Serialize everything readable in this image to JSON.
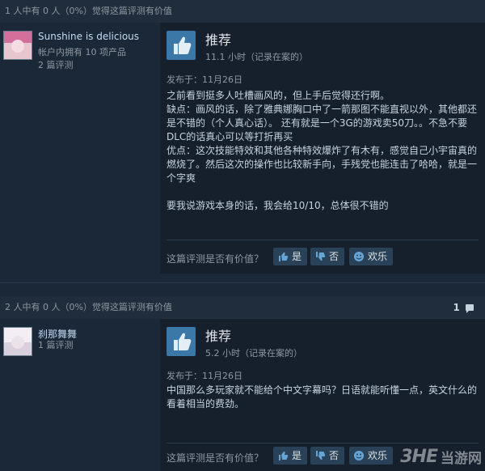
{
  "reviews": [
    {
      "helpful_text": "1 人中有 0 人（0%）觉得这篇评测有价值",
      "comment_count": "",
      "username": "Sunshine is delicious",
      "products_owned": "帐户内拥有 10 项产品",
      "review_count": "2 篇评测",
      "recommendation": "推荐",
      "hours": "11.1 小时（记录在案的）",
      "posted": "发布于：11月26日",
      "body": [
        "之前看到挺多人吐槽画风的，但上手后觉得还行啊。",
        "缺点：画风的话，除了雅典娜胸口中了一箭那图不能直视以外，其他都还是不错的（个人真心话）。 还有就是一个3G的游戏卖50刀。。不急不要DLC的话真心可以等打折再买",
        "优点：这次技能特效和其他各种特效爆炸了有木有，感觉自己小宇宙真的燃烧了。然后这次的操作也比较新手向，手残党也能连击了哈哈，就是一个字爽",
        "",
        "要我说游戏本身的话，我会给10/10，总体很不错的"
      ],
      "question": "这篇评测是否有价值？",
      "yes_label": "是",
      "no_label": "否",
      "funny_label": "欢乐"
    },
    {
      "helpful_text": "2 人中有 0 人（0%）觉得这篇评测有价值",
      "comment_count": "1",
      "username": "刹那舞舞",
      "products_owned": "",
      "review_count": "1 篇评测",
      "recommendation": "推荐",
      "hours": "5.2 小时（记录在案的）",
      "posted": "发布于：11月26日",
      "body": [
        "中国那么多玩家就不能给个中文字幕吗？日语就能听懂一点，英文什么的看着相当的费劲。"
      ],
      "question": "这篇评测是否有价值？",
      "yes_label": "是",
      "no_label": "否",
      "funny_label": "欢乐"
    }
  ],
  "watermark": {
    "logo": "3HE",
    "site": "当游网"
  },
  "icons": {
    "recommend": "thumbs-up-icon",
    "yes": "thumbs-up-icon",
    "no": "thumbs-down-icon",
    "funny": "smiley-icon",
    "comment": "comment-icon"
  },
  "colors": {
    "background": "#1b2838",
    "panel": "#16202d",
    "thumb_box": "#3b78a7",
    "button": "#2a4257",
    "username": "#c1dbf4"
  }
}
